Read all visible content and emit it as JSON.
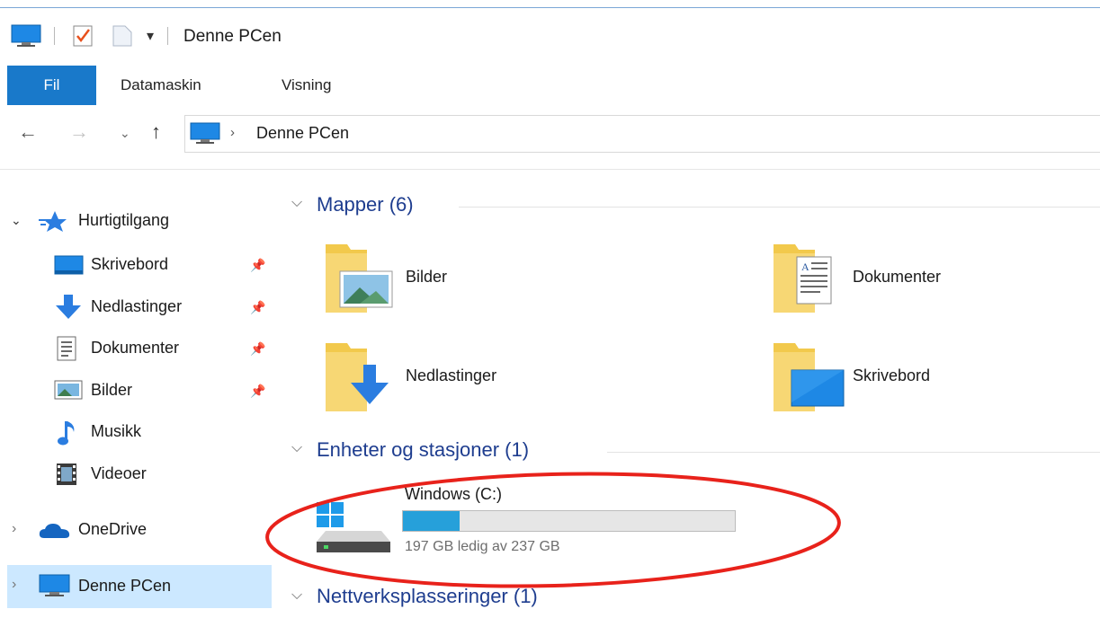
{
  "window": {
    "title": "Denne PCen"
  },
  "ribbon": {
    "tabs": [
      "Fil",
      "Datamaskin",
      "Visning"
    ]
  },
  "address": {
    "path": "Denne PCen"
  },
  "sidebar": {
    "quick_access": "Hurtigtilgang",
    "items": [
      {
        "label": "Skrivebord",
        "icon": "desktop-icon",
        "pinned": true
      },
      {
        "label": "Nedlastinger",
        "icon": "download-icon",
        "pinned": true
      },
      {
        "label": "Dokumenter",
        "icon": "document-icon",
        "pinned": true
      },
      {
        "label": "Bilder",
        "icon": "pictures-icon",
        "pinned": true
      },
      {
        "label": "Musikk",
        "icon": "music-icon",
        "pinned": false
      },
      {
        "label": "Videoer",
        "icon": "video-icon",
        "pinned": false
      }
    ],
    "onedrive": "OneDrive",
    "this_pc": "Denne PCen"
  },
  "main": {
    "folders_header": "Mapper (6)",
    "folders": [
      "Bilder",
      "Dokumenter",
      "Nedlastinger",
      "Skrivebord"
    ],
    "drives_header": "Enheter og stasjoner (1)",
    "drive": {
      "name": "Windows (C:)",
      "free_text": "197 GB ledig av 237 GB",
      "used_fraction": 0.17
    },
    "network_header": "Nettverksplasseringer (1)"
  },
  "colors": {
    "accent": "#1979ca",
    "selected": "#cce8ff",
    "bar_fill": "#26a0da",
    "annotation": "#e8221b"
  }
}
